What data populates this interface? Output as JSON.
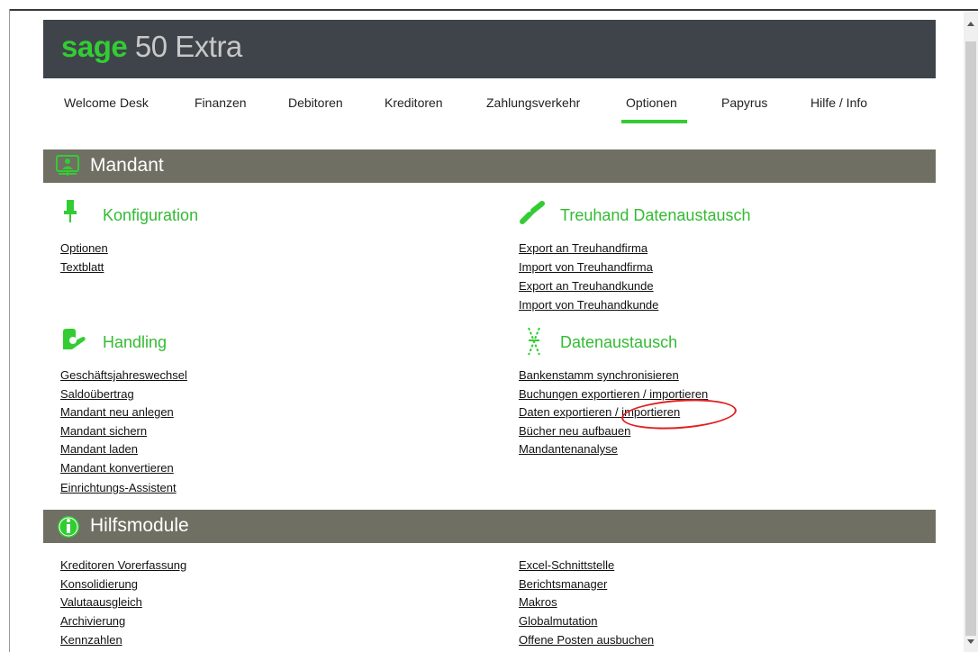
{
  "app": {
    "logo_brand": "sage",
    "logo_product": "50 Extra"
  },
  "nav": {
    "items": [
      "Welcome Desk",
      "Finanzen",
      "Debitoren",
      "Kreditoren",
      "Zahlungsverkehr",
      "Optionen",
      "Papyrus",
      "Hilfe / Info"
    ],
    "active": "Optionen"
  },
  "sections": {
    "mandant": {
      "title": "Mandant",
      "konfiguration": {
        "title": "Konfiguration",
        "links": [
          "Optionen",
          "Textblatt"
        ]
      },
      "treuhand": {
        "title": "Treuhand Datenaustausch",
        "links": [
          "Export an Treuhandfirma",
          "Import von Treuhandfirma",
          "Export an Treuhandkunde",
          "Import von Treuhandkunde"
        ]
      },
      "handling": {
        "title": "Handling",
        "links": [
          "Geschäftsjahreswechsel",
          "Saldoübertrag",
          "Mandant neu anlegen",
          "Mandant sichern",
          "Mandant laden",
          "Mandant konvertieren",
          "Einrichtungs-Assistent"
        ]
      },
      "datenaustausch": {
        "title": "Datenaustausch",
        "links": [
          "Bankenstamm synchronisieren",
          "Buchungen exportieren / importieren",
          "Daten exportieren / importieren",
          "Bücher neu aufbauen",
          "Mandantenanalyse"
        ]
      }
    },
    "hilfsmodule": {
      "title": "Hilfsmodule",
      "left_links": [
        "Kreditoren Vorerfassung",
        "Konsolidierung",
        "Valutaausgleich",
        "Archivierung",
        "Kennzahlen"
      ],
      "right_links": [
        "Excel-Schnittstelle",
        "Berichtsmanager",
        "Makros",
        "Globalmutation",
        "Offene Posten ausbuchen"
      ]
    }
  },
  "colors": {
    "accent": "#33cc33",
    "header_bg": "#3e444a",
    "section_bg": "#6f6f63",
    "annotation": "#e02020"
  }
}
